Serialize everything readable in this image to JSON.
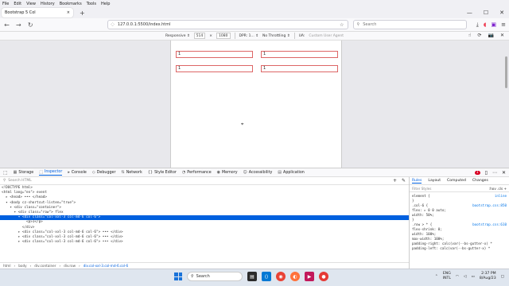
{
  "menu": [
    "File",
    "Edit",
    "View",
    "History",
    "Bookmarks",
    "Tools",
    "Help"
  ],
  "tab": {
    "title": "Bootstrap 5 Col",
    "close": "×"
  },
  "new_tab": "+",
  "window_controls": {
    "minimize": "—",
    "maximize": "☐",
    "close": "✕"
  },
  "nav": {
    "back": "←",
    "forward": "→",
    "reload": "↻",
    "url": "127.0.0.1:5500/index.html",
    "search_placeholder": "Search",
    "search_icon": "⚲",
    "icons": [
      "download-icon",
      "pocket-icon",
      "extensions-icon",
      "menu-icon"
    ]
  },
  "rdm": {
    "device": "Responsive ⇕",
    "width": "514",
    "sep_x": "×",
    "height": "1080",
    "dpr": "DPR: 1... ⇕",
    "throttle": "No Throttling ⇕",
    "ua_label": "UA:",
    "ua_placeholder": "Custom User Agent",
    "touch": "☝",
    "rotate": "⟳",
    "screenshot": "📷",
    "close": "✕"
  },
  "page": {
    "fields": [
      "1",
      "1",
      "1",
      "1"
    ]
  },
  "devtools": {
    "tabs": [
      {
        "label": "Storage",
        "icon": "▦"
      },
      {
        "label": "Inspector",
        "icon": "⬚",
        "active": true
      },
      {
        "label": "Console",
        "icon": "▸"
      },
      {
        "label": "Debugger",
        "icon": "◇"
      },
      {
        "label": "Network",
        "icon": "⇅"
      },
      {
        "label": "Style Editor",
        "icon": "{}"
      },
      {
        "label": "Performance",
        "icon": "◔"
      },
      {
        "label": "Memory",
        "icon": "◉"
      },
      {
        "label": "Accessibility",
        "icon": "☺"
      },
      {
        "label": "Application",
        "icon": "▤"
      }
    ],
    "error_count": "1",
    "search_placeholder": "Search HTML",
    "tree": [
      "<!DOCTYPE html>",
      "<html lang=\"en\"> event",
      "  ▸ <head> ••• </head>",
      "  ▾ <body cz-shortcut-listen=\"true\">",
      "    ▾ <div class=\"container\">",
      "      ▾ <div class=\"row\"> flex",
      "        ▾ <div class=\"col-xxl-3 col-md-6 col-6\">",
      "            <p>1</p>",
      "          </div>",
      "        ▸ <div class=\"col-xxl-3 col-md-6 col-6\"> ••• </div>",
      "        ▸ <div class=\"col-xxl-3 col-md-6 col-6\"> ••• </div>",
      "        ▸ <div class=\"col-xxl-3 col-md-6 col-6\"> ••• </div>"
    ],
    "selected_line": 6,
    "breadcrumbs": [
      "html",
      "body",
      "div.container",
      "div.row",
      "div.col-xxl-3.col-md-6.col-6"
    ],
    "rules_tabs": [
      "Rules",
      "Layout",
      "Computed",
      "Changes"
    ],
    "rules_active": "Rules",
    "rules_filter": "Filter Styles",
    "rules_pseudo": ":hov .cls +",
    "rules": [
      {
        "selector": "element {",
        "src": "inline"
      },
      {
        "selector": "}",
        "src": ""
      },
      {
        "selector": ".col-6 {",
        "src": "bootstrap.css:850"
      },
      {
        "selector": "  flex: ▸ 0 0 auto;",
        "src": ""
      },
      {
        "selector": "  width: 50%;",
        "src": ""
      },
      {
        "selector": "}",
        "src": ""
      },
      {
        "selector": ".row > * {",
        "src": "bootstrap.css:610"
      },
      {
        "selector": "  flex-shrink: 0;",
        "src": ""
      },
      {
        "selector": "  width: 100%;",
        "src": ""
      },
      {
        "selector": "  max-width: 100%;",
        "src": ""
      },
      {
        "selector": "  padding-right: calc(var(--bs-gutter-x) *",
        "src": ""
      },
      {
        "selector": "  padding-left: calc(var(--bs-gutter-x) *",
        "src": ""
      }
    ]
  },
  "taskbar": {
    "search_label": "Search",
    "lang_top": "ENG",
    "lang_bottom": "INTL",
    "time": "2:37 PM",
    "date": "8/Aug/23"
  }
}
